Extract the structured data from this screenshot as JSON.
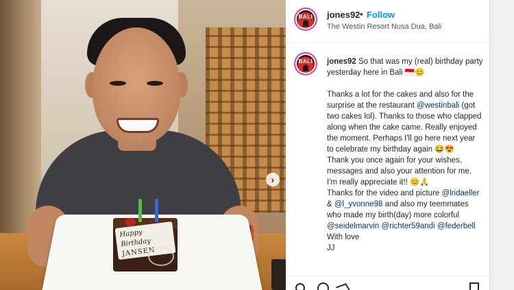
{
  "post": {
    "username": "jones92",
    "separator": "•",
    "follow_label": "Follow",
    "location": "The Westin Resort Nusa Dua, Bali",
    "avatar_logo": "BALI",
    "photo": {
      "cake_card_line1": "Happy Birthday",
      "cake_card_line2": "JANSEN"
    },
    "caption": {
      "username": "jones92",
      "intro": " So that was my (real) birthday party yesterday here in Bali 🇮🇩😊",
      "p1_a": "Thanks a lot for the cakes and also for the surprise at the restaurant ",
      "p1_mention": "@westinbali",
      "p1_b": " (got two cakes lol). Thanks to those who clapped along when the cake came. Really enjoyed the moment. Perhaps I'll go here next year to celebrate my birthday again 😂😍",
      "p2": "Thank you once again for your wishes, messages and also your attention for me. I'm really appreciate it!! 😊🙏",
      "p3_a": "Thanks for the video and picture ",
      "p3_m1": "@lridaeller",
      "p3_amp": " & ",
      "p3_m2": "@l_yvonne98",
      "p3_b": " and also my teemmates who made my birth(day) more colorful ",
      "p3_m3": "@seidelmarvin",
      "p3_m4": "@richter59andi",
      "p3_m5": "@federbell",
      "sign_1": "With love",
      "sign_2": "JJ"
    }
  },
  "icons": {
    "like": "heart-icon",
    "comment": "comment-icon",
    "share": "share-icon",
    "save": "bookmark-icon",
    "carousel_next": "chevron-right-icon"
  },
  "colors": {
    "follow_blue": "#0095f6",
    "mention": "#00376b",
    "text": "#262626"
  }
}
